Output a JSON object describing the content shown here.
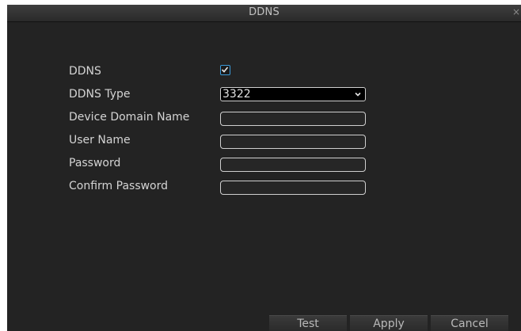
{
  "window": {
    "title": "DDNS",
    "close_glyph": "×"
  },
  "form": {
    "ddns_label": "DDNS",
    "ddns_enabled": true,
    "ddns_type_label": "DDNS Type",
    "ddns_type_value": "3322",
    "device_domain_label": "Device Domain Name",
    "device_domain_value": "",
    "user_name_label": "User Name",
    "user_name_value": "",
    "password_label": "Password",
    "password_value": "",
    "confirm_password_label": "Confirm Password",
    "confirm_password_value": ""
  },
  "buttons": {
    "test": "Test",
    "apply": "Apply",
    "cancel": "Cancel"
  },
  "colors": {
    "background": "#232323",
    "accent": "#3a9ad9",
    "text": "#d4d4d4"
  },
  "icons": {
    "close": "close-icon",
    "checkbox": "check-icon",
    "dropdown": "chevron-down-icon"
  }
}
